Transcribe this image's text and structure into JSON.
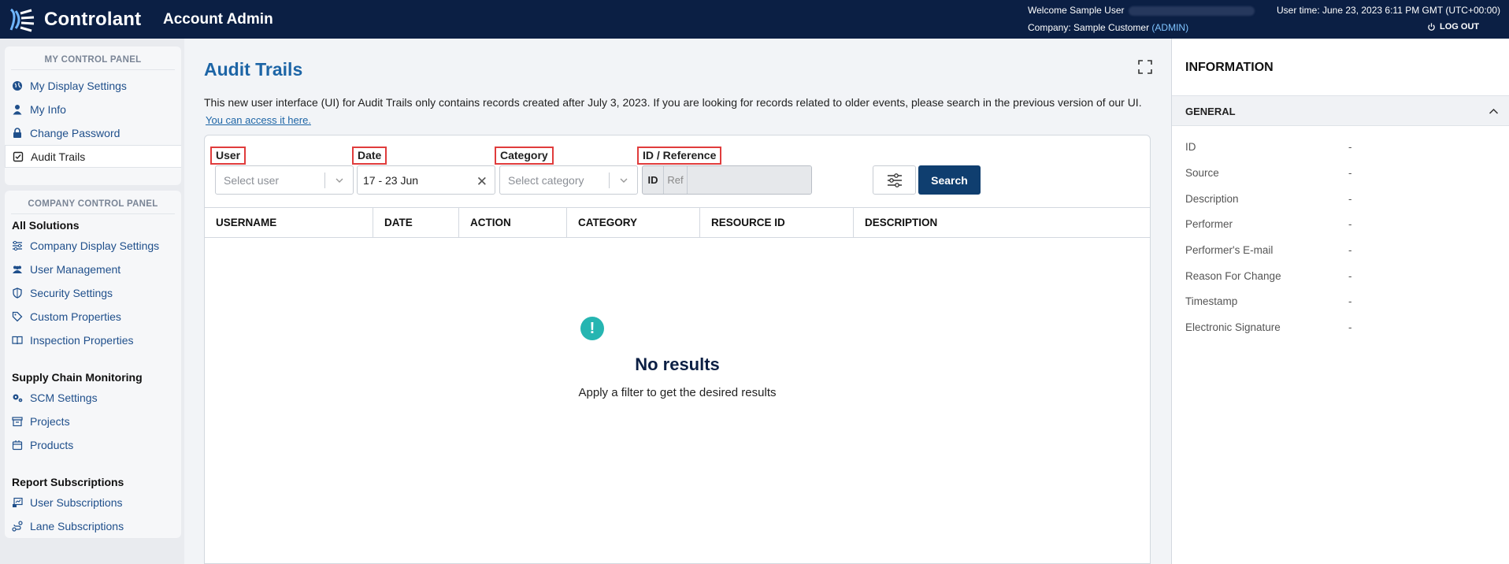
{
  "header": {
    "brand": "Controlant",
    "app_title": "Account Admin",
    "welcome": "Welcome Sample User",
    "company_label": "Company: Sample Customer",
    "company_role": "(ADMIN)",
    "user_time": "User time: June 23, 2023 6:11 PM GMT (UTC+00:00)",
    "logout": "LOG OUT"
  },
  "sidebar": {
    "my_panel_title": "MY CONTROL PANEL",
    "my_items": [
      {
        "label": "My Display Settings",
        "icon": "globe-icon"
      },
      {
        "label": "My Info",
        "icon": "user-icon"
      },
      {
        "label": "Change Password",
        "icon": "lock-icon"
      },
      {
        "label": "Audit Trails",
        "icon": "checkbox-icon"
      }
    ],
    "company_panel_title": "COMPANY CONTROL PANEL",
    "all_solutions": "All Solutions",
    "all_items": [
      {
        "label": "Company Display Settings",
        "icon": "sliders-icon"
      },
      {
        "label": "User Management",
        "icon": "users-icon"
      },
      {
        "label": "Security Settings",
        "icon": "shield-icon"
      },
      {
        "label": "Custom Properties",
        "icon": "tag-icon"
      },
      {
        "label": "Inspection Properties",
        "icon": "book-icon"
      }
    ],
    "scm_heading": "Supply Chain Monitoring",
    "scm_items": [
      {
        "label": "SCM Settings",
        "icon": "gears-icon"
      },
      {
        "label": "Projects",
        "icon": "archive-icon"
      },
      {
        "label": "Products",
        "icon": "box-icon"
      }
    ],
    "report_heading": "Report Subscriptions",
    "report_items": [
      {
        "label": "User Subscriptions",
        "icon": "chart-subscription-icon"
      },
      {
        "label": "Lane Subscriptions",
        "icon": "route-icon"
      }
    ]
  },
  "main": {
    "title": "Audit Trails",
    "notice": "This new user interface (UI) for Audit Trails only contains records created after July 3, 2023. If you are looking for records related to older events, please search in the previous version of our UI.",
    "access_link": "You can access it here.",
    "filters": {
      "user_label": "User",
      "user_placeholder": "Select user",
      "date_label": "Date",
      "date_value": "17 - 23 Jun",
      "category_label": "Category",
      "category_placeholder": "Select category",
      "idref_label": "ID / Reference",
      "id_tab": "ID",
      "ref_tab": "Ref",
      "search": "Search"
    },
    "columns": [
      "USERNAME",
      "DATE",
      "ACTION",
      "CATEGORY",
      "RESOURCE ID",
      "DESCRIPTION"
    ],
    "empty_title": "No results",
    "empty_subtitle": "Apply a filter to get the desired results"
  },
  "info": {
    "title": "INFORMATION",
    "section": "GENERAL",
    "rows": [
      {
        "label": "ID",
        "value": "-"
      },
      {
        "label": "Source",
        "value": "-"
      },
      {
        "label": "Description",
        "value": "-"
      },
      {
        "label": "Performer",
        "value": "-"
      },
      {
        "label": "Performer's E-mail",
        "value": "-"
      },
      {
        "label": "Reason For Change",
        "value": "-"
      },
      {
        "label": "Timestamp",
        "value": "-"
      },
      {
        "label": "Electronic Signature",
        "value": "-"
      }
    ]
  },
  "colors": {
    "header_bg": "#0b1f44",
    "accent": "#1d65a6",
    "search_button": "#0f3e6f",
    "empty_icon": "#26b5b1",
    "highlight": "#e03c3c"
  }
}
